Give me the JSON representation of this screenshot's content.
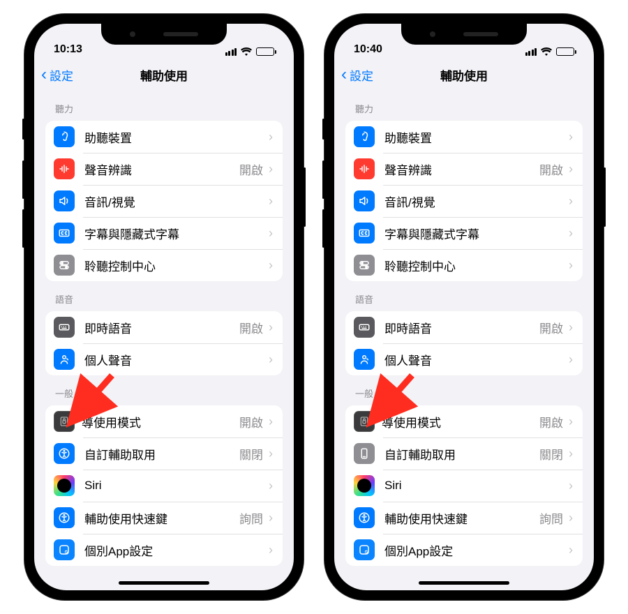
{
  "phones": [
    {
      "time": "10:13",
      "nav": {
        "back": "設定",
        "title": "輔助使用"
      },
      "sections": [
        {
          "header": "聽力",
          "rows": [
            {
              "icon": "i-blue",
              "glyph": "ear",
              "label": "助聽裝置",
              "value": ""
            },
            {
              "icon": "i-red",
              "glyph": "wave",
              "label": "聲音辨識",
              "value": "開啟"
            },
            {
              "icon": "i-blue",
              "glyph": "speak",
              "label": "音訊/視覺",
              "value": ""
            },
            {
              "icon": "i-blue",
              "glyph": "cc",
              "label": "字幕與隱藏式字幕",
              "value": ""
            },
            {
              "icon": "i-gray",
              "glyph": "control",
              "label": "聆聽控制中心",
              "value": ""
            }
          ]
        },
        {
          "header": "語音",
          "rows": [
            {
              "icon": "i-darkgray",
              "glyph": "keyboard",
              "label": "即時語音",
              "value": "開啟"
            },
            {
              "icon": "i-blue",
              "glyph": "voice",
              "label": "個人聲音",
              "value": ""
            }
          ]
        },
        {
          "header": "一般",
          "rows": [
            {
              "icon": "i-guided",
              "glyph": "lock",
              "label": "導使用模式",
              "value": "開啟",
              "truncated": true
            },
            {
              "icon": "i-blue",
              "glyph": "access",
              "label": "自訂輔助取用",
              "value": "關閉"
            },
            {
              "icon": "i-siri",
              "glyph": "",
              "label": "Siri",
              "value": ""
            },
            {
              "icon": "i-blue",
              "glyph": "access",
              "label": "輔助使用快速鍵",
              "value": "詢問"
            },
            {
              "icon": "i-blue2",
              "glyph": "app",
              "label": "個別App設定",
              "value": ""
            }
          ]
        }
      ]
    },
    {
      "time": "10:40",
      "nav": {
        "back": "設定",
        "title": "輔助使用"
      },
      "sections": [
        {
          "header": "聽力",
          "rows": [
            {
              "icon": "i-blue",
              "glyph": "ear",
              "label": "助聽裝置",
              "value": ""
            },
            {
              "icon": "i-red",
              "glyph": "wave",
              "label": "聲音辨識",
              "value": "開啟"
            },
            {
              "icon": "i-blue",
              "glyph": "speak",
              "label": "音訊/視覺",
              "value": ""
            },
            {
              "icon": "i-blue",
              "glyph": "cc",
              "label": "字幕與隱藏式字幕",
              "value": ""
            },
            {
              "icon": "i-gray",
              "glyph": "control",
              "label": "聆聽控制中心",
              "value": ""
            }
          ]
        },
        {
          "header": "語音",
          "rows": [
            {
              "icon": "i-darkgray",
              "glyph": "keyboard",
              "label": "即時語音",
              "value": "開啟"
            },
            {
              "icon": "i-blue",
              "glyph": "voice",
              "label": "個人聲音",
              "value": ""
            }
          ]
        },
        {
          "header": "一般",
          "rows": [
            {
              "icon": "i-guided",
              "glyph": "lock",
              "label": "導使用模式",
              "value": "開啟",
              "truncated": true
            },
            {
              "icon": "i-gray",
              "glyph": "phone",
              "label": "自訂輔助取用",
              "value": "關閉"
            },
            {
              "icon": "i-siri",
              "glyph": "",
              "label": "Siri",
              "value": ""
            },
            {
              "icon": "i-blue",
              "glyph": "access",
              "label": "輔助使用快速鍵",
              "value": "詢問"
            },
            {
              "icon": "i-blue2",
              "glyph": "app",
              "label": "個別App設定",
              "value": ""
            }
          ]
        }
      ]
    }
  ],
  "arrow_color": "#ff2d1f"
}
